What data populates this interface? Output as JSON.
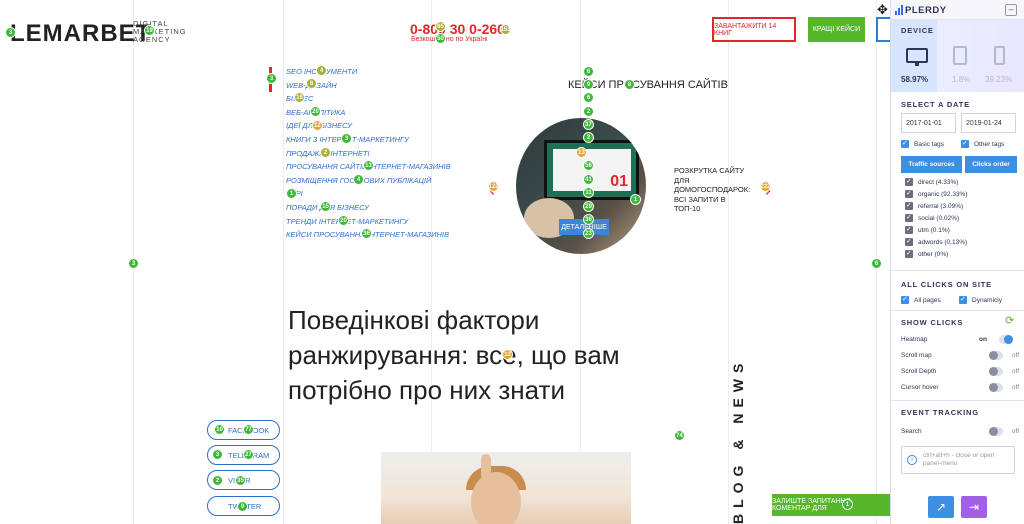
{
  "site": {
    "logo": "LEMARBET",
    "logo_sub": "DIGITAL MARKETING AGENCY",
    "phone": "0-800 30 0-260",
    "phone_sub": "Безкоштовно по Україні",
    "btn_download": "ЗАВАНТАЖИТИ 14 КНИГ",
    "btn_cases": "КРАЩІ КЕЙСИ",
    "menu": [
      "SEO ІНСТРУМЕНТИ",
      "WEB-ДИЗАЙН",
      "БІЗНЕС",
      "ВЕБ-АНАЛІТИКА",
      "ІДЕЇ ДЛЯ БІЗНЕСУ",
      "КНИГИ З ІНТЕРНЕТ-МАРКЕТИНГУ",
      "ПРОДАЖІ В ІНТЕРНЕТІ",
      "ПРОСУВАННЯ САЙТІВ ІНТЕРНЕТ-МАГАЗИНІВ",
      "РОЗМІЩЕННЯ ГОСТЬОВИХ ПУБЛІКАЦІЙ",
      "ГОРІ",
      "ПОРАДИ ДЛЯ БІЗНЕСУ",
      "ТРЕНДИ ІНТЕРНЕТ-МАРКЕТИНГУ",
      "КЕЙСИ ПРОСУВАННЯ ІНТЕРНЕТ-МАГАЗИНІВ"
    ],
    "case_title": "КЕЙСИ ПРОСУВАННЯ САЙТІВ",
    "case_screen_num": "01",
    "case_desc": "РОЗКРУТКА САЙТУ ДЛЯ ДОМОГОСПОДАРОК: ВСІ ЗАПИТИ В ТОП-10",
    "details": "ДЕТАЛЬНІШЕ",
    "arrow_left": "‹",
    "arrow_right": "›",
    "headline": "Поведінкові фактори ранжирування: все, що вам потрібно про них знати",
    "blog_vertical": "BLOG & NEWS",
    "social": [
      "FACEBOOK",
      "TELEGRAM",
      "VIBER",
      "TWITTER"
    ],
    "ask_btn": "ЗАЛИШТЕ ЗАПИТАННЯ КОМЕНТАР ДЛЯ",
    "click_counts": [
      "3",
      "19",
      "65",
      "50",
      "21",
      "153",
      "6",
      "9",
      "8",
      "6",
      "3",
      "2",
      "13",
      "5",
      "37",
      "2",
      "13",
      "56",
      "29",
      "50",
      "2",
      "20",
      "4",
      "41",
      "11",
      "1",
      "22",
      "36",
      "23",
      "122",
      "222",
      "3",
      "6",
      "74",
      "10",
      "77",
      "3",
      "27",
      "2",
      "35",
      "9",
      "1",
      "15",
      "20",
      "4",
      "6",
      "18",
      "12",
      "3",
      "2"
    ]
  },
  "panel": {
    "brand": "PLERDY",
    "collapse": "–",
    "device_title": "DEVICE",
    "devices": [
      {
        "name": "desktop",
        "percent": "58.97%",
        "active": true
      },
      {
        "name": "tablet",
        "percent": "1.8%",
        "active": false
      },
      {
        "name": "mobile",
        "percent": "39.23%",
        "active": false
      }
    ],
    "select_date_title": "SELECT A DATE",
    "date_from": "2017-01-01",
    "date_to": "2019-01-24",
    "basic_tags": "Basic tags",
    "other_tags": "Other tags",
    "btn_traffic": "Traffic sources",
    "btn_clicks": "Clicks order",
    "sources": [
      "direct (4.33%)",
      "organic (92.33%)",
      "referral (3.09%)",
      "social (0.02%)",
      "utm (0.1%)",
      "adwords (0.13%)",
      "other (0%)"
    ],
    "all_clicks_title": "ALL CLICKS ON SITE",
    "all_pages": "All pages",
    "dynamicly": "Dynamicly",
    "show_clicks_title": "SHOW CLICKS",
    "toggles": [
      {
        "label": "Heatmap",
        "state": "on"
      },
      {
        "label": "Scroll map",
        "state": "off"
      },
      {
        "label": "Scroll Depth",
        "state": "off"
      },
      {
        "label": "Cursor hover",
        "state": "off"
      }
    ],
    "event_tracking_title": "EVENT TRACKING",
    "search_label": "Search",
    "search_state": "off",
    "shortcut_hint": "ctrl+alt+h - close or open panel-menu",
    "info_glyph": "i"
  }
}
